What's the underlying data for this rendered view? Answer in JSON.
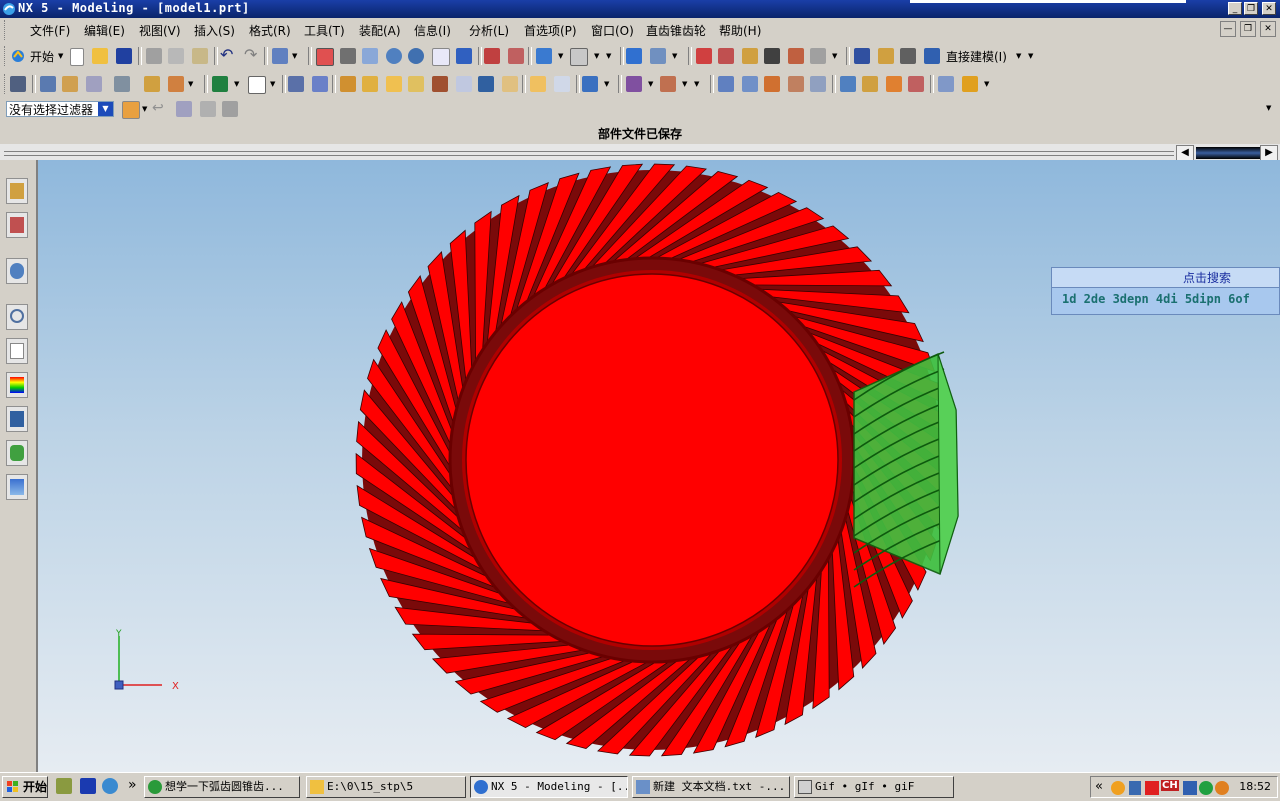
{
  "window": {
    "title": "NX 5 - Modeling - [model1.prt]",
    "controls": [
      "_",
      "❐",
      "✕"
    ]
  },
  "menu": {
    "items": [
      "文件(F)",
      "编辑(E)",
      "视图(V)",
      "插入(S)",
      "格式(R)",
      "工具(T)",
      "装配(A)",
      "信息(I)",
      "分析(L)",
      "首选项(P)",
      "窗口(O)",
      "直齿锥齿轮",
      "帮助(H)"
    ],
    "mdi_controls": [
      "—",
      "❐",
      "✕"
    ]
  },
  "toolbar1": {
    "start_label": "开始",
    "direct_modeling_label": "直接建模(I)"
  },
  "filter": {
    "selected": "没有选择过滤器"
  },
  "status": {
    "message": "部件文件已保存"
  },
  "popup": {
    "title": "点击搜索",
    "body": "1d 2de 3depn 4di 5dipn 6of"
  },
  "axes": {
    "x_label": "X",
    "y_label": "Y"
  },
  "taskbar": {
    "start_label": "开始",
    "quicklaunch_more": "»",
    "tasks": [
      {
        "label": "想学一下弧齿圆锥齿...",
        "icon": "ie-icon"
      },
      {
        "label": "E:\\0\\15_stp\\5",
        "icon": "folder-icon"
      },
      {
        "label": "NX 5 - Modeling - [...",
        "icon": "nx-icon",
        "active": true
      },
      {
        "label": "新建 文本文档.txt -...",
        "icon": "notepad-icon"
      },
      {
        "label": "Gif • gIf • giF",
        "icon": "gif-icon"
      }
    ],
    "tray_chevron": "«",
    "tray_lang": "CH",
    "clock": "18:52"
  },
  "colors": {
    "gear_red": "#ff0000",
    "gear_tooth_dark": "#7a0a0a",
    "pinion_green": "#3fbf3f",
    "title_bar": "#0a246a",
    "viewport_top": "#8fb8dc"
  }
}
